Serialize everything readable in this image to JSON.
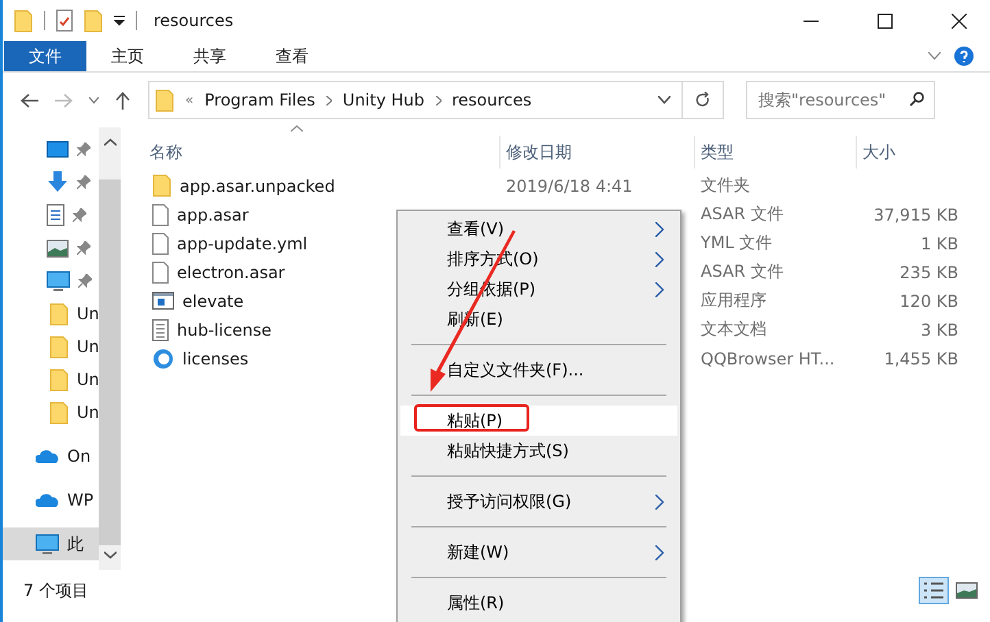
{
  "window": {
    "title": "resources"
  },
  "ribbon_tabs": [
    {
      "label": "文件",
      "selected": true
    },
    {
      "label": "主页",
      "selected": false
    },
    {
      "label": "共享",
      "selected": false
    },
    {
      "label": "查看",
      "selected": false
    }
  ],
  "address": {
    "prefix": "«",
    "crumbs": [
      "Program Files",
      "Unity Hub",
      "resources"
    ]
  },
  "search": {
    "placeholder": "搜索\"resources\""
  },
  "sidebar": {
    "items": [
      {
        "kind": "desktop",
        "pinned": true,
        "selected": false
      },
      {
        "kind": "download",
        "pinned": true,
        "selected": false
      },
      {
        "kind": "document",
        "pinned": true,
        "selected": false
      },
      {
        "kind": "image",
        "pinned": true,
        "selected": false
      },
      {
        "kind": "monitor",
        "pinned": true,
        "selected": false
      },
      {
        "kind": "folder",
        "label": "Un",
        "pinned": false,
        "selected": false
      },
      {
        "kind": "folder",
        "label": "Un",
        "pinned": false,
        "selected": false
      },
      {
        "kind": "folder",
        "label": "Un",
        "pinned": false,
        "selected": false
      },
      {
        "kind": "folder",
        "label": "Un",
        "pinned": false,
        "selected": false
      },
      {
        "kind": "cloud",
        "label": "On",
        "pinned": false,
        "selected": false
      },
      {
        "kind": "cloud",
        "label": "WP",
        "pinned": false,
        "selected": false
      },
      {
        "kind": "pc",
        "label": "此",
        "pinned": false,
        "selected": true
      }
    ]
  },
  "table": {
    "columns": [
      "名称",
      "修改日期",
      "类型",
      "大小"
    ],
    "rows": [
      {
        "kind": "folder",
        "name": "app.asar.unpacked",
        "date": "2019/6/18 4:41",
        "type": "文件夹"
      },
      {
        "kind": "file",
        "name": "app.asar",
        "type": "ASAR 文件",
        "size": "37,915 KB"
      },
      {
        "kind": "file",
        "name": "app-update.yml",
        "type": "YML 文件",
        "size": "1 KB"
      },
      {
        "kind": "file",
        "name": "electron.asar",
        "type": "ASAR 文件",
        "size": "235 KB"
      },
      {
        "kind": "app",
        "name": "elevate",
        "type": "应用程序",
        "size": "120 KB"
      },
      {
        "kind": "text",
        "name": "hub-license",
        "type": "文本文档",
        "size": "3 KB"
      },
      {
        "kind": "browser",
        "name": "licenses",
        "type": "QQBrowser HT...",
        "size": "1,455 KB"
      }
    ]
  },
  "context_menu": [
    {
      "kind": "item",
      "label": "查看(V)",
      "submenu": true,
      "selected": false,
      "marked": false
    },
    {
      "kind": "item",
      "label": "排序方式(O)",
      "submenu": true,
      "selected": false,
      "marked": false
    },
    {
      "kind": "item",
      "label": "分组依据(P)",
      "submenu": true,
      "selected": false,
      "marked": false
    },
    {
      "kind": "item",
      "label": "刷新(E)",
      "submenu": false,
      "selected": false,
      "marked": false
    },
    {
      "kind": "separator"
    },
    {
      "kind": "item",
      "label": "自定义文件夹(F)...",
      "submenu": false,
      "selected": false,
      "marked": false
    },
    {
      "kind": "separator"
    },
    {
      "kind": "item",
      "label": "粘贴(P)",
      "submenu": false,
      "selected": true,
      "marked": true
    },
    {
      "kind": "item",
      "label": "粘贴快捷方式(S)",
      "submenu": false,
      "selected": false,
      "marked": false
    },
    {
      "kind": "separator"
    },
    {
      "kind": "item",
      "label": "授予访问权限(G)",
      "submenu": true,
      "selected": false,
      "marked": false
    },
    {
      "kind": "separator"
    },
    {
      "kind": "item",
      "label": "新建(W)",
      "submenu": true,
      "selected": false,
      "marked": false
    },
    {
      "kind": "separator"
    },
    {
      "kind": "item",
      "label": "属性(R)",
      "submenu": false,
      "selected": false,
      "marked": false
    }
  ],
  "status_bar": {
    "count": "7 个项目"
  }
}
